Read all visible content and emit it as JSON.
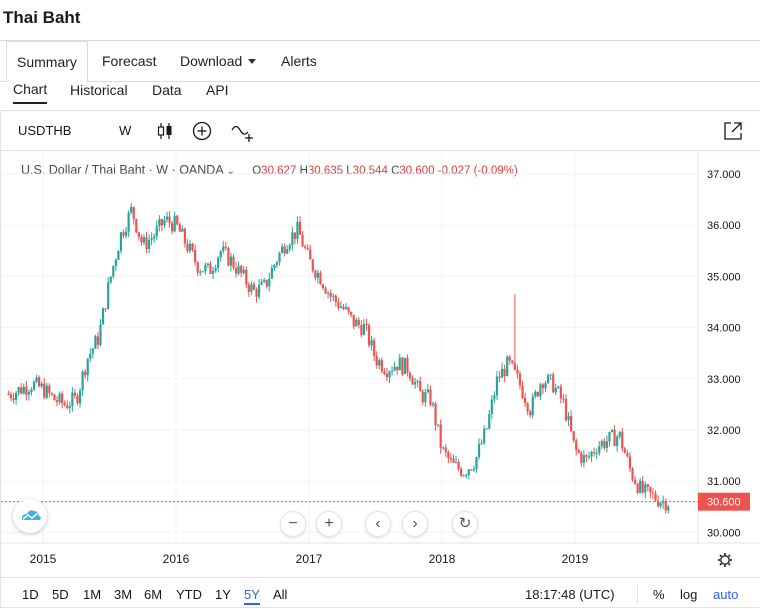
{
  "page": {
    "title": "Thai Baht"
  },
  "top_tabs": [
    {
      "label": "Summary",
      "active": true
    },
    {
      "label": "Forecast"
    },
    {
      "label": "Download"
    },
    {
      "label": "Alerts"
    }
  ],
  "sub_tabs": [
    {
      "label": "Chart",
      "active": true
    },
    {
      "label": "Historical"
    },
    {
      "label": "Data"
    },
    {
      "label": "API"
    }
  ],
  "toolbar": {
    "symbol": "USDTHB",
    "interval": "W",
    "icons": [
      "candles-icon",
      "add-indicator-icon",
      "compare-icon",
      "popout-icon"
    ]
  },
  "legend": {
    "name": "U.S. Dollar / Thai Baht",
    "interval": "W",
    "source": "OANDA",
    "o_label": "O",
    "o": "30.627",
    "h_label": "H",
    "h": "30.635",
    "l_label": "L",
    "l": "30.544",
    "c_label": "C",
    "c": "30.600",
    "change": "-0.027 (-0.09%)"
  },
  "colors": {
    "up": "#26a69a",
    "down": "#ef5350",
    "price_line": "#ef5350",
    "accent": "#2962ff"
  },
  "chart_data": {
    "type": "candlestick",
    "x_axis_labels": [
      "2015",
      "2016",
      "2017",
      "2018",
      "2019"
    ],
    "y_axis_labels": [
      "37.000",
      "36.000",
      "35.000",
      "34.000",
      "33.000",
      "32.000",
      "31.000",
      "30.000"
    ],
    "ylim": [
      29.8,
      37.4
    ],
    "last_price": "30.600",
    "close_series": [
      [
        "2014-10",
        32.7
      ],
      [
        "2014-11",
        32.8
      ],
      [
        "2014-12",
        32.9
      ],
      [
        "2015-01",
        32.8
      ],
      [
        "2015-02",
        32.6
      ],
      [
        "2015-03",
        32.5
      ],
      [
        "2015-04",
        32.6
      ],
      [
        "2015-05",
        33.4
      ],
      [
        "2015-06",
        33.8
      ],
      [
        "2015-07",
        34.9
      ],
      [
        "2015-08",
        35.8
      ],
      [
        "2015-09",
        36.3
      ],
      [
        "2015-10",
        35.6
      ],
      [
        "2015-11",
        35.8
      ],
      [
        "2015-12",
        36.1
      ],
      [
        "2016-01",
        36.0
      ],
      [
        "2016-02",
        35.6
      ],
      [
        "2016-03",
        35.2
      ],
      [
        "2016-04",
        35.1
      ],
      [
        "2016-05",
        35.5
      ],
      [
        "2016-06",
        35.3
      ],
      [
        "2016-07",
        35.0
      ],
      [
        "2016-08",
        34.7
      ],
      [
        "2016-09",
        34.8
      ],
      [
        "2016-10",
        35.3
      ],
      [
        "2016-11",
        35.7
      ],
      [
        "2016-12",
        35.9
      ],
      [
        "2017-01",
        35.3
      ],
      [
        "2017-02",
        35.0
      ],
      [
        "2017-03",
        34.6
      ],
      [
        "2017-04",
        34.4
      ],
      [
        "2017-05",
        34.1
      ],
      [
        "2017-06",
        34.0
      ],
      [
        "2017-07",
        33.4
      ],
      [
        "2017-08",
        33.2
      ],
      [
        "2017-09",
        33.3
      ],
      [
        "2017-10",
        33.2
      ],
      [
        "2017-11",
        32.7
      ],
      [
        "2017-12",
        32.6
      ],
      [
        "2018-01",
        31.6
      ],
      [
        "2018-02",
        31.3
      ],
      [
        "2018-03",
        31.2
      ],
      [
        "2018-04",
        31.4
      ],
      [
        "2018-05",
        32.0
      ],
      [
        "2018-06",
        33.0
      ],
      [
        "2018-07",
        33.3
      ],
      [
        "2018-08",
        32.9
      ],
      [
        "2018-09",
        32.4
      ],
      [
        "2018-10",
        33.0
      ],
      [
        "2018-11",
        32.9
      ],
      [
        "2018-12",
        32.5
      ],
      [
        "2019-01",
        31.6
      ],
      [
        "2019-02",
        31.4
      ],
      [
        "2019-03",
        31.7
      ],
      [
        "2019-04",
        31.8
      ],
      [
        "2019-05",
        31.9
      ],
      [
        "2019-06",
        31.2
      ],
      [
        "2019-07",
        30.8
      ],
      [
        "2019-08",
        30.7
      ],
      [
        "2019-09",
        30.6
      ]
    ]
  },
  "nav_buttons": [
    "zoom-out",
    "zoom-in",
    "scroll-left",
    "scroll-right",
    "reset"
  ],
  "ranges": [
    {
      "label": "1D"
    },
    {
      "label": "5D"
    },
    {
      "label": "1M"
    },
    {
      "label": "3M"
    },
    {
      "label": "6M"
    },
    {
      "label": "YTD"
    },
    {
      "label": "1Y"
    },
    {
      "label": "5Y",
      "active": true
    },
    {
      "label": "All"
    }
  ],
  "bottom": {
    "time": "18:17:48 (UTC)",
    "percent": "%",
    "log": "log",
    "auto": "auto"
  }
}
